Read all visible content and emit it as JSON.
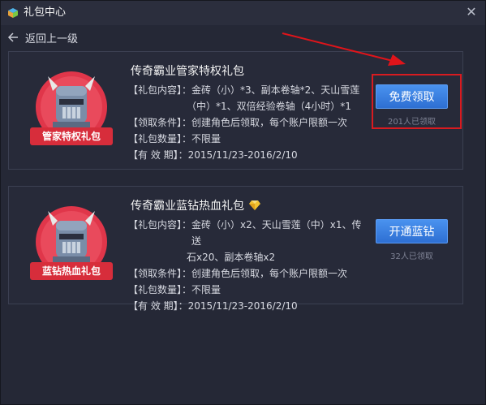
{
  "window": {
    "title": "礼包中心",
    "close_icon": "close-icon"
  },
  "nav": {
    "back_label": "返回上一级",
    "back_icon": "arrow-left-icon"
  },
  "gifts": [
    {
      "badge_label": "管家特权礼包",
      "title": "传奇霸业管家特权礼包",
      "content_label": "【礼包内容】：",
      "content_line1": "金砖（小）*3、副本卷轴*2、天山雪莲",
      "content_line2": "（中）*1、双倍经验卷轴（4小时）*1",
      "condition_label": "【领取条件】：",
      "condition_value": "创建角色后领取，每个账户限额一次",
      "quantity_label": "【礼包数量】：",
      "quantity_value": "不限量",
      "validity_label": "【有 效 期】：",
      "validity_value": "2015/11/23-2016/2/10",
      "button_label": "免费领取",
      "claimed_count": "201人已领取"
    },
    {
      "badge_label": "蓝钻热血礼包",
      "title": "传奇霸业蓝钻热血礼包",
      "title_icon": "diamond-icon",
      "content_label": "【礼包内容】：",
      "content_line1": "金砖（小）x2、天山雪莲（中）x1、传送",
      "content_line2": "石x20、副本卷轴x2",
      "condition_label": "【领取条件】：",
      "condition_value": "创建角色后领取，每个账户限额一次",
      "quantity_label": "【礼包数量】：",
      "quantity_value": "不限量",
      "validity_label": "【有 效 期】：",
      "validity_value": "2015/11/23-2016/2/10",
      "button_label": "开通蓝钻",
      "claimed_count": "32人已领取"
    }
  ],
  "colors": {
    "background": "#252836",
    "accent_blue": "#3a7fe2",
    "badge_red": "#d72d3b",
    "highlight_red": "#d81b20"
  }
}
